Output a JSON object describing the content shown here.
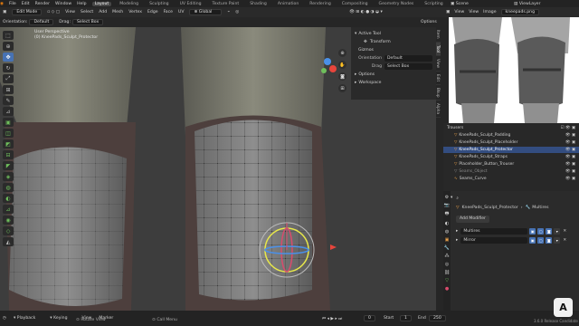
{
  "menu": [
    "File",
    "Edit",
    "Render",
    "Window",
    "Help"
  ],
  "workspace_tabs": [
    "Layout",
    "Modeling",
    "Sculpting",
    "UV Editing",
    "Texture Paint",
    "Shading",
    "Animation",
    "Rendering",
    "Compositing",
    "Geometry Nodes",
    "Scripting"
  ],
  "active_workspace": "Layout",
  "scene": "Scene",
  "view_layer": "ViewLayer",
  "viewport_header": {
    "mode": "Edit Mode",
    "menus": [
      "View",
      "Select",
      "Add",
      "Mesh",
      "Vertex",
      "Edge",
      "Face",
      "UV"
    ],
    "orientation": "Global"
  },
  "tool_settings": {
    "orientation_label": "Orientation:",
    "orientation_value": "Default",
    "drag_label": "Drag:",
    "drag_value": "Select Box",
    "options": "Options"
  },
  "viewport_overlay": {
    "view_name": "User Perspective",
    "object_name": "(0) KneePads_Sculpt_Protector"
  },
  "npanel": {
    "active_tool": "Active Tool",
    "transform": "Transform",
    "gizmos": "Gizmos",
    "orientation_label": "Orientation",
    "orientation_value": "Default",
    "drag_label": "Drag",
    "drag_value": "Select Box",
    "options": "Options",
    "workspace": "Workspace"
  },
  "npanel_tabs": [
    "Item",
    "Tool",
    "View",
    "Edit",
    "Bkup",
    "Alpha"
  ],
  "image_editor": {
    "menus": [
      "View",
      "View",
      "Image"
    ],
    "image_name": "kneepads.png"
  },
  "outliner": {
    "items": [
      {
        "name": "Trousers",
        "selected": false,
        "indent": 0
      },
      {
        "name": "KneePads_Sculpt_Padding",
        "selected": false,
        "indent": 1
      },
      {
        "name": "KneePads_Sculpt_Placeholder",
        "selected": false,
        "indent": 1
      },
      {
        "name": "KneePads_Sculpt_Protector",
        "selected": true,
        "indent": 1
      },
      {
        "name": "KneePads_Sculpt_Straps",
        "selected": false,
        "indent": 1
      },
      {
        "name": "Placeholder_Button_Trouser",
        "selected": false,
        "indent": 1
      },
      {
        "name": "Seams_Object",
        "selected": false,
        "indent": 1
      },
      {
        "name": "Seams_Curve",
        "selected": false,
        "indent": 1
      }
    ]
  },
  "properties": {
    "object": "KneePads_Sculpt_Protector",
    "modifier_type": "Multires",
    "add_modifier": "Add Modifier",
    "modifiers": [
      "Multires",
      "Mirror"
    ]
  },
  "statusbar": {
    "playback": "Playback",
    "keying": "Keying",
    "view": "View",
    "marker": "Marker",
    "hint_rotate": "Rotate View",
    "hint_menu": "Call Menu",
    "start_label": "Start",
    "start_val": "1",
    "end_label": "End",
    "end_val": "250",
    "current_frame": "0",
    "version": "3.6.0 Release Candidate"
  },
  "avatar_letter": "A"
}
